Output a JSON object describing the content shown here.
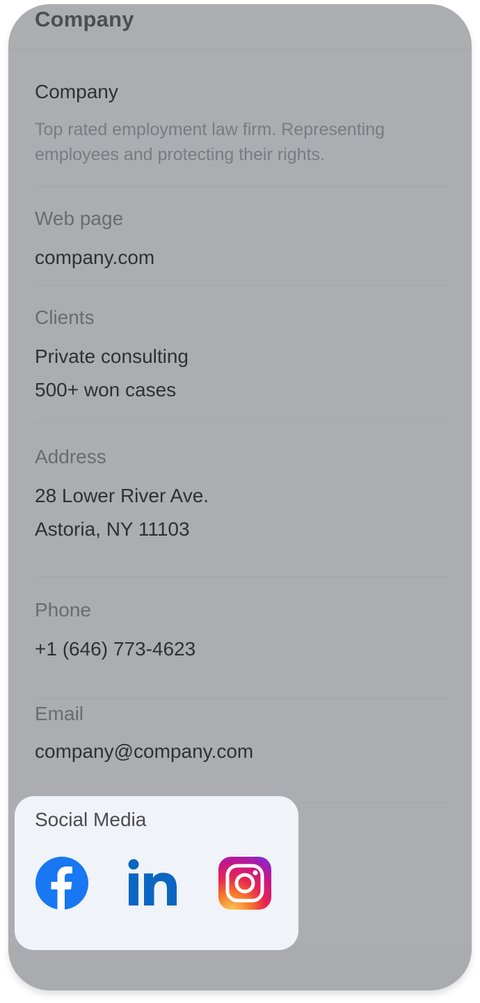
{
  "header": {
    "title": "Company"
  },
  "company": {
    "name": "Company",
    "description": "Top rated employment law firm. Representing employees and protecting their rights."
  },
  "web_page": {
    "label": "Web page",
    "value": "company.com"
  },
  "clients": {
    "label": "Clients",
    "lines": [
      "Private consulting",
      "500+ won cases"
    ]
  },
  "address": {
    "label": "Address",
    "lines": [
      "28 Lower River Ave.",
      "Astoria, NY 11103"
    ]
  },
  "phone": {
    "label": "Phone",
    "value": "+1 (646) 773-4623"
  },
  "email": {
    "label": "Email",
    "value": "company@company.com"
  },
  "social": {
    "title": "Social Media",
    "icons": [
      "facebook-icon",
      "linkedin-icon",
      "instagram-icon"
    ]
  },
  "colors": {
    "overlay": "#acadb1",
    "card": "#f0f3f8",
    "facebook": "#1877f2",
    "linkedin": "#0a66c2"
  }
}
